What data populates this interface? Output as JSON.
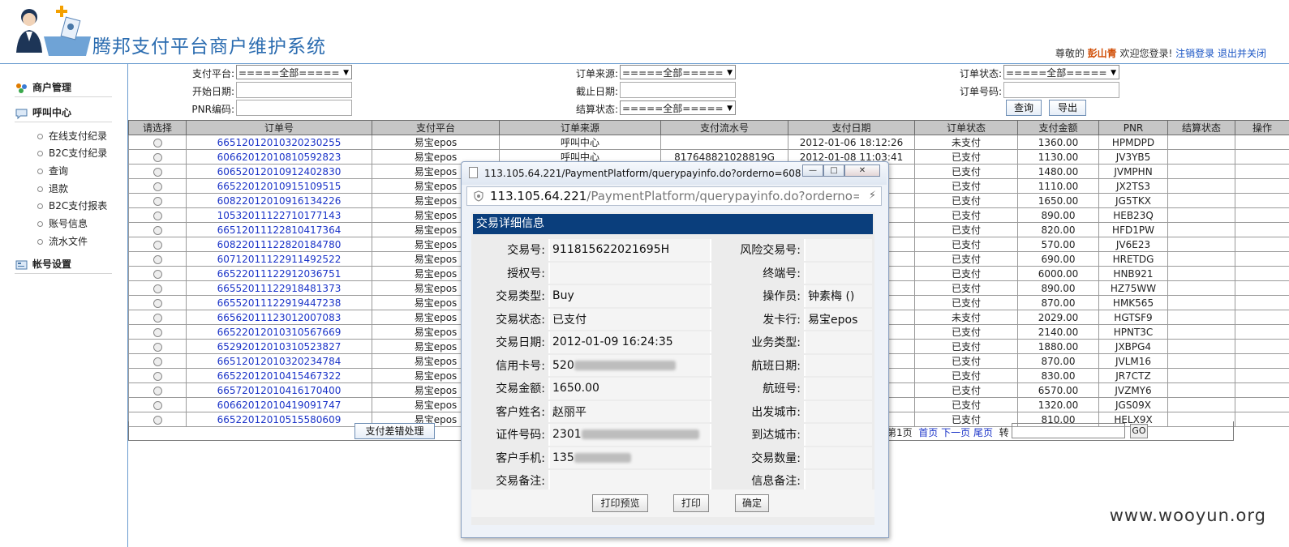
{
  "header": {
    "title": "腾邦支付平台商户维护系统",
    "greeting": "尊敬的",
    "user": "彭山青",
    "welcome": "欢迎您登录!",
    "logout": "注销登录",
    "exit_close": "退出并关闭"
  },
  "sidebar": {
    "groups": [
      {
        "label": "商户管理"
      },
      {
        "label": "呼叫中心"
      },
      {
        "label": "帐号设置"
      }
    ],
    "items": [
      {
        "label": "在线支付纪录"
      },
      {
        "label": "B2C支付纪录"
      },
      {
        "label": "查询"
      },
      {
        "label": "退款"
      },
      {
        "label": "B2C支付报表"
      },
      {
        "label": "账号信息"
      },
      {
        "label": "流水文件"
      }
    ]
  },
  "search": {
    "pay_platform_label": "支付平台:",
    "pay_platform_value": "=====全部=====",
    "order_source_label": "订单来源:",
    "order_source_value": "=====全部=====",
    "order_status_label": "订单状态:",
    "order_status_value": "=====全部=====",
    "start_date_label": "开始日期:",
    "end_date_label": "截止日期:",
    "order_no_label": "订单号码:",
    "pnr_label": "PNR编码:",
    "settle_status_label": "结算状态:",
    "settle_status_value": "=====全部=====",
    "query_button": "查询",
    "export_button": "导出"
  },
  "table": {
    "columns": [
      "请选择",
      "订单号",
      "支付平台",
      "订单来源",
      "支付流水号",
      "支付日期",
      "订单状态",
      "支付金额",
      "PNR",
      "结算状态",
      "操作"
    ],
    "rows": [
      {
        "order": "66512012010320230255",
        "platform": "易宝epos",
        "source": "呼叫中心",
        "serial": "",
        "date": "2012-01-06 18:12:26",
        "status": "未支付",
        "amount": "1360.00",
        "pnr": "HPMDPD"
      },
      {
        "order": "60662012010810592823",
        "platform": "易宝epos",
        "source": "呼叫中心",
        "serial": "817648821028819G",
        "date": "2012-01-08 11:03:41",
        "status": "已支付",
        "amount": "1130.00",
        "pnr": "JV3YB5"
      },
      {
        "order": "60652012010912402830",
        "platform": "易宝epos",
        "source": "",
        "serial": "",
        "date": "38",
        "status": "已支付",
        "amount": "1480.00",
        "pnr": "JVMPHN"
      },
      {
        "order": "66522012010915109515",
        "platform": "易宝epos",
        "source": "",
        "serial": "",
        "date": "26",
        "status": "已支付",
        "amount": "1110.00",
        "pnr": "JX2TS3"
      },
      {
        "order": "60822012010916134226",
        "platform": "易宝epos",
        "source": "",
        "serial": "",
        "date": "35",
        "status": "已支付",
        "amount": "1650.00",
        "pnr": "JG5TKX"
      },
      {
        "order": "10532011122710177143",
        "platform": "易宝epos",
        "source": "",
        "serial": "",
        "date": "22",
        "status": "已支付",
        "amount": "890.00",
        "pnr": "HEB23Q"
      },
      {
        "order": "66512011122810417364",
        "platform": "易宝epos",
        "source": "",
        "serial": "",
        "date": "39",
        "status": "已支付",
        "amount": "820.00",
        "pnr": "HFD1PW"
      },
      {
        "order": "60822011122820184780",
        "platform": "易宝epos",
        "source": "",
        "serial": "",
        "date": "02",
        "status": "已支付",
        "amount": "570.00",
        "pnr": "JV6E23"
      },
      {
        "order": "60712011122911492522",
        "platform": "易宝epos",
        "source": "",
        "serial": "",
        "date": "15",
        "status": "已支付",
        "amount": "690.00",
        "pnr": "HRETDG"
      },
      {
        "order": "66522011122912036751",
        "platform": "易宝epos",
        "source": "",
        "serial": "",
        "date": "20",
        "status": "已支付",
        "amount": "6000.00",
        "pnr": "HNB921"
      },
      {
        "order": "66552011122918481373",
        "platform": "易宝epos",
        "source": "",
        "serial": "",
        "date": "51",
        "status": "已支付",
        "amount": "890.00",
        "pnr": "HZ75WW"
      },
      {
        "order": "66552011122919447238",
        "platform": "易宝epos",
        "source": "",
        "serial": "",
        "date": "02",
        "status": "已支付",
        "amount": "870.00",
        "pnr": "HMK565"
      },
      {
        "order": "66562011123012007083",
        "platform": "易宝epos",
        "source": "",
        "serial": "",
        "date": "13",
        "status": "未支付",
        "amount": "2029.00",
        "pnr": "HGTSF9"
      },
      {
        "order": "66522012010310567669",
        "platform": "易宝epos",
        "source": "",
        "serial": "",
        "date": "43",
        "status": "已支付",
        "amount": "2140.00",
        "pnr": "HPNT3C"
      },
      {
        "order": "65292012010310523827",
        "platform": "易宝epos",
        "source": "",
        "serial": "",
        "date": "14",
        "status": "已支付",
        "amount": "1880.00",
        "pnr": "JXBPG4"
      },
      {
        "order": "66512012010320234784",
        "platform": "易宝epos",
        "source": "",
        "serial": "",
        "date": "51",
        "status": "已支付",
        "amount": "870.00",
        "pnr": "JVLM16"
      },
      {
        "order": "66522012010415467322",
        "platform": "易宝epos",
        "source": "",
        "serial": "",
        "date": "53",
        "status": "已支付",
        "amount": "830.00",
        "pnr": "JR7CTZ"
      },
      {
        "order": "66572012010416170400",
        "platform": "易宝epos",
        "source": "",
        "serial": "",
        "date": "02",
        "status": "已支付",
        "amount": "6570.00",
        "pnr": "JVZMY6"
      },
      {
        "order": "60662012010419091747",
        "platform": "易宝epos",
        "source": "",
        "serial": "",
        "date": "21",
        "status": "已支付",
        "amount": "1320.00",
        "pnr": "JGS09X"
      },
      {
        "order": "66522012010515580609",
        "platform": "易宝epos",
        "source": "",
        "serial": "",
        "date": "24",
        "status": "已支付",
        "amount": "810.00",
        "pnr": "HELX9X"
      }
    ],
    "error_button": "支付差错处理",
    "pager_page": "第1页",
    "pager_first": "首页",
    "pager_next": "下一页",
    "pager_last": "尾页",
    "pager_goto": "转",
    "go_button": "GO"
  },
  "popup": {
    "title": "113.105.64.221/PaymentPlatform/querypayinfo.do?orderno=6082...",
    "address_host": "113.105.64.221",
    "address_path": "/PaymentPlatform/querypayinfo.do?orderno=",
    "detail_header": "交易详细信息",
    "rows": [
      {
        "l1": "交易号:",
        "v1": "911815622021695H",
        "l2": "风险交易号:",
        "v2": ""
      },
      {
        "l1": "授权号:",
        "v1": "",
        "l2": "终端号:",
        "v2": ""
      },
      {
        "l1": "交易类型:",
        "v1": "Buy",
        "l2": "操作员:",
        "v2": "钟素梅 ()"
      },
      {
        "l1": "交易状态:",
        "v1": "已支付",
        "l2": "发卡行:",
        "v2": "易宝epos"
      },
      {
        "l1": "交易日期:",
        "v1": "2012-01-09 16:24:35",
        "l2": "业务类型:",
        "v2": ""
      },
      {
        "l1": "信用卡号:",
        "v1": "520",
        "l2": "航班日期:",
        "v2": ""
      },
      {
        "l1": "交易金额:",
        "v1": "1650.00",
        "l2": "航班号:",
        "v2": ""
      },
      {
        "l1": "客户姓名:",
        "v1": "赵丽平",
        "l2": "出发城市:",
        "v2": ""
      },
      {
        "l1": "证件号码:",
        "v1": "2301",
        "l2": "到达城市:",
        "v2": ""
      },
      {
        "l1": "客户手机:",
        "v1": "135",
        "l2": "交易数量:",
        "v2": ""
      },
      {
        "l1": "交易备注:",
        "v1": "",
        "l2": "信息备注:",
        "v2": ""
      }
    ],
    "print_preview_button": "打印预览",
    "print_button": "打印",
    "ok_button": "确定"
  },
  "watermark": "www.wooyun.org"
}
